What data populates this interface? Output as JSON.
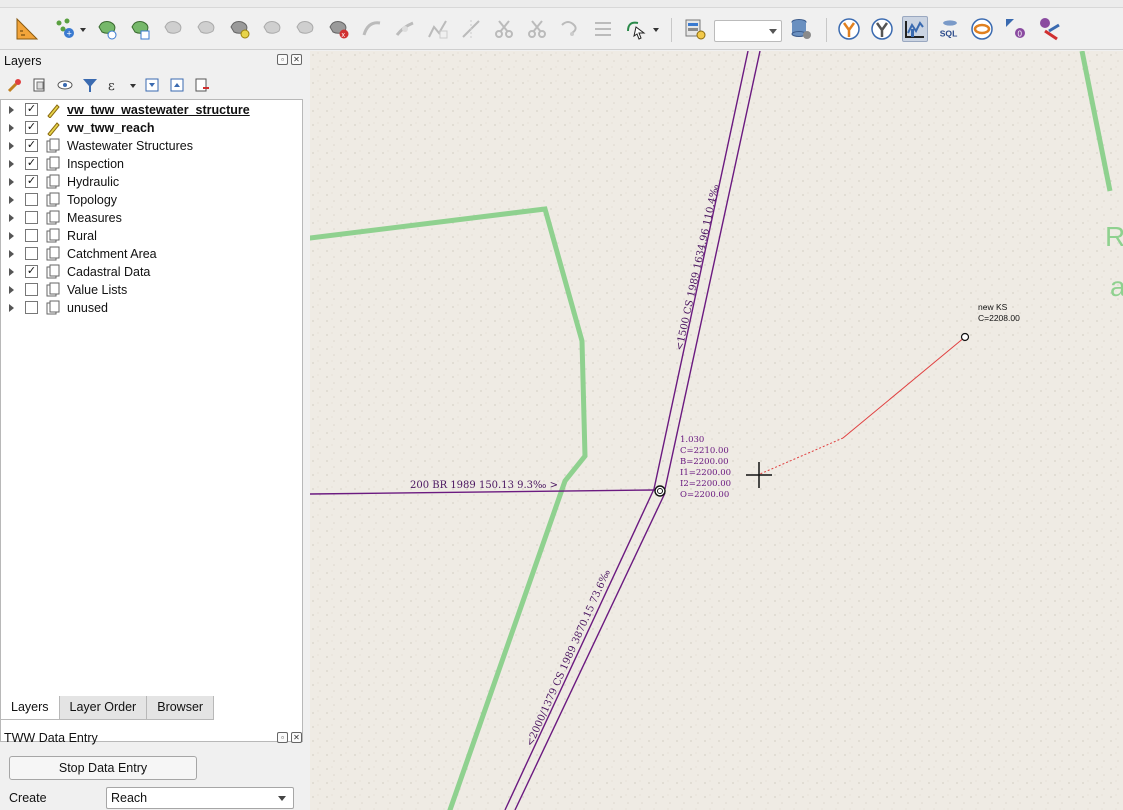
{
  "colors": {
    "pipe": "#6b1a80",
    "green": "#7ecb7e",
    "map_bg": "#efebe4",
    "red_line": "#e04040"
  },
  "layers_panel": {
    "title": "Layers",
    "items": [
      {
        "label": "vw_tww_wastewater_structure",
        "checked": true,
        "icon": "editable-layer-icon",
        "bold": true,
        "underline": true
      },
      {
        "label": "vw_tww_reach",
        "checked": true,
        "icon": "editable-layer-icon",
        "bold": true,
        "underline": false
      },
      {
        "label": "Wastewater Structures",
        "checked": true,
        "icon": "group-icon",
        "bold": false
      },
      {
        "label": "Inspection",
        "checked": true,
        "icon": "group-icon",
        "bold": false
      },
      {
        "label": "Hydraulic",
        "checked": true,
        "icon": "group-icon",
        "bold": false
      },
      {
        "label": "Topology",
        "checked": false,
        "icon": "group-icon",
        "bold": false
      },
      {
        "label": "Measures",
        "checked": false,
        "icon": "group-icon",
        "bold": false
      },
      {
        "label": "Rural",
        "checked": false,
        "icon": "group-icon",
        "bold": false
      },
      {
        "label": "Catchment Area",
        "checked": false,
        "icon": "group-icon",
        "bold": false
      },
      {
        "label": "Cadastral Data",
        "checked": true,
        "icon": "group-icon",
        "bold": false
      },
      {
        "label": "Value Lists",
        "checked": false,
        "icon": "group-icon",
        "bold": false
      },
      {
        "label": "unused",
        "checked": false,
        "icon": "group-icon",
        "bold": false
      }
    ]
  },
  "tabs": [
    "Layers",
    "Layer Order",
    "Browser"
  ],
  "active_tab": "Layers",
  "tww_panel": {
    "title": "TWW Data Entry",
    "stop_button": "Stop Data Entry",
    "create_label": "Create",
    "create_value": "Reach"
  },
  "map": {
    "upper_pipe_label": "<1500 CS 1989 1634.96 110.4‰",
    "lower_pipe_label": "<2000/1379 CS 1989 3870.15 73.6‰",
    "side_pipe_label": "200 BR 1989 150.13 9.3‰ >",
    "node_labels": [
      "1.030",
      "C=2210.00",
      "B=2200.00",
      "I1=2200.00",
      "I2=2200.00",
      "O=2200.00"
    ],
    "new_ks_labels": [
      "new KS",
      "C=2208.00"
    ]
  },
  "toolbar": {
    "sql_label": "SQL",
    "zero_label": "0"
  }
}
